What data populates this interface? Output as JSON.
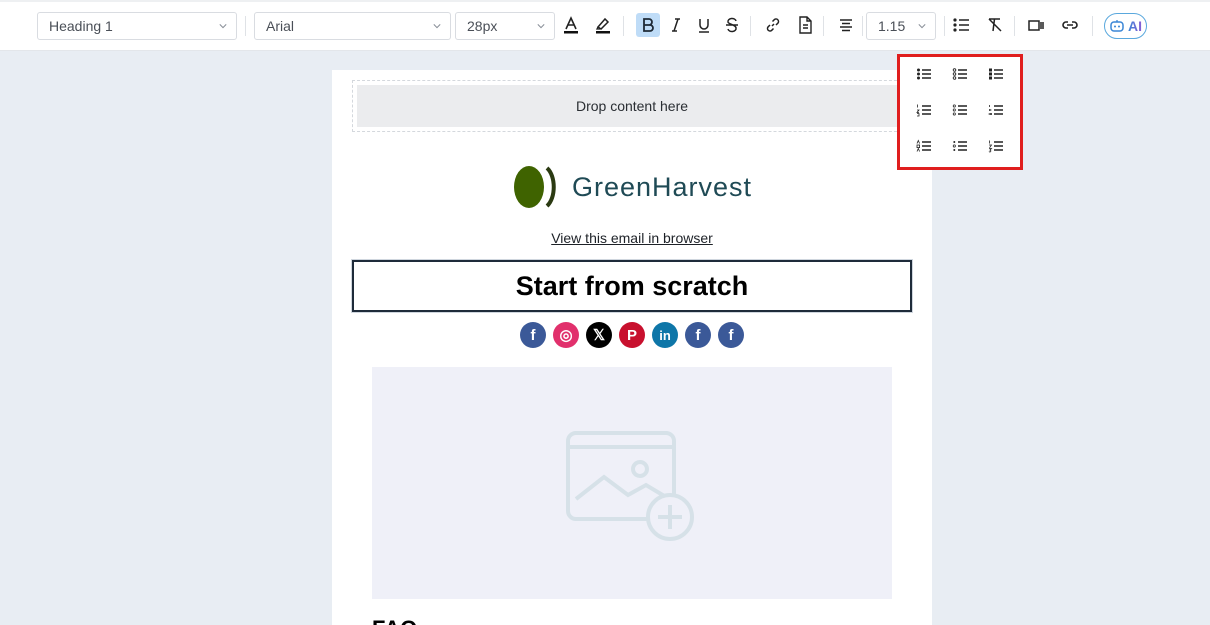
{
  "toolbar": {
    "block_format": "Heading 1",
    "font_family": "Arial",
    "font_size": "28px",
    "line_height": "1.15",
    "ai_label": "AI"
  },
  "list_styles": {
    "icons": [
      "bullet-disc-list-icon",
      "bullet-circle-list-icon",
      "bullet-square-list-icon",
      "numbered-list-icon",
      "lower-alpha-list-icon",
      "lower-roman-list-icon",
      "upper-alpha-list-icon",
      "lower-greek-list-icon",
      "upper-roman-list-icon"
    ]
  },
  "email": {
    "drop_text": "Drop content here",
    "brand_name": "GreenHarvest",
    "view_link": "View this email in browser",
    "headline": "Start from scratch",
    "faq_heading": "FAQ",
    "social": [
      {
        "name": "facebook",
        "color": "#3b5998",
        "glyph": "f"
      },
      {
        "name": "instagram",
        "color": "#e1306c",
        "glyph": "◎"
      },
      {
        "name": "x",
        "color": "#000000",
        "glyph": "𝕏"
      },
      {
        "name": "pinterest",
        "color": "#c8102e",
        "glyph": "P"
      },
      {
        "name": "linkedin",
        "color": "#0e76a8",
        "glyph": "in"
      },
      {
        "name": "facebook",
        "color": "#3b5998",
        "glyph": "f"
      },
      {
        "name": "facebook",
        "color": "#3b5998",
        "glyph": "f"
      }
    ]
  },
  "colors": {
    "highlight_box": "#e01e1e",
    "active_button": "#bfdcf7",
    "brand_text": "#1f4a55",
    "brand_leaf": "#3f6300"
  }
}
